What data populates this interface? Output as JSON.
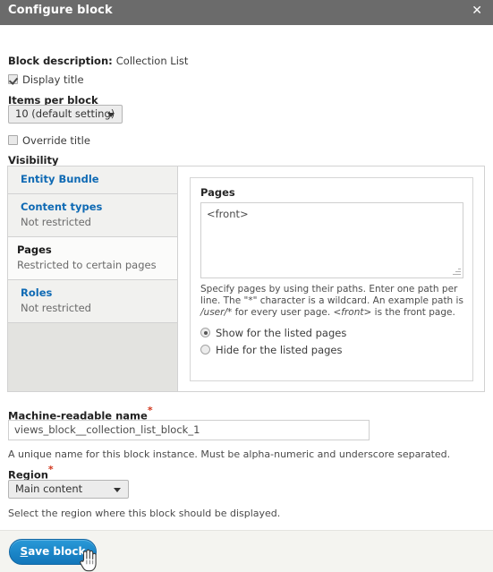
{
  "window": {
    "title": "Configure block",
    "close_icon": "close-icon",
    "close_glyph": "✕"
  },
  "form": {
    "block_description_label": "Block description:",
    "block_description_value": "Collection List",
    "display_title": {
      "label": "Display title",
      "checked": true
    },
    "items_per_block": {
      "label": "Items per block",
      "selected": "10 (default setting)",
      "arrow_icon": "chevron-down-icon"
    },
    "override_title": {
      "label": "Override title",
      "checked": false
    },
    "visibility_label": "Visibility",
    "machine_name": {
      "label": "Machine-readable name",
      "required_marker": "*",
      "value": "views_block__collection_list_block_1",
      "description": "A unique name for this block instance. Must be alpha-numeric and underscore separated."
    },
    "region": {
      "label": "Region",
      "required_marker": "*",
      "selected": "Main content",
      "arrow_icon": "chevron-down-icon",
      "description": "Select the region where this block should be displayed."
    }
  },
  "vertical_tabs": [
    {
      "title": "Entity Bundle",
      "summary": "",
      "active": false
    },
    {
      "title": "Content types",
      "summary": "Not restricted",
      "active": false
    },
    {
      "title": "Pages",
      "summary": "Restricted to certain pages",
      "active": true
    },
    {
      "title": "Roles",
      "summary": "Not restricted",
      "active": false
    }
  ],
  "pages_pane": {
    "legend": "Pages",
    "textarea_value": "<front>",
    "help_line_1": "Specify pages by using their paths. Enter one path per line.",
    "help_line_2_a": "The \"*\" character is a wildcard. An example path is ",
    "help_line_2_b": "/user/*",
    "help_line_3_a": "for every user page. ",
    "help_line_3_b": "<front>",
    "help_line_3_c": " is the front page.",
    "radio_show": "Show for the listed pages",
    "radio_hide": "Hide for the listed pages",
    "radio_selected": "show"
  },
  "footer": {
    "save_label_first": "S",
    "save_label_rest": "ave block",
    "cursor_icon": "hand-pointer-cursor"
  },
  "colors": {
    "titlebar_bg": "#6b6b6b",
    "accent_link": "#0f6ab4",
    "button_blue": "#1b86c8",
    "required_red": "#d1351b",
    "tab_col_bg": "#e3e3e0"
  }
}
